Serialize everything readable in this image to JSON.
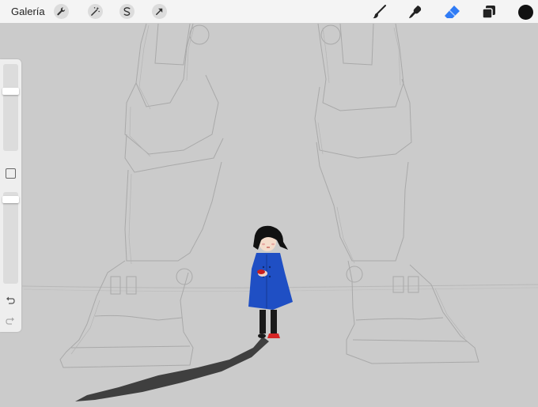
{
  "toolbar": {
    "gallery_label": "Galería",
    "left_tools": [
      "wrench-icon",
      "magic-wand-icon",
      "selection-icon",
      "transform-arrow-icon"
    ],
    "right_tools": [
      "brush-icon",
      "smudge-icon",
      "eraser-icon",
      "layers-icon",
      "color-swatch"
    ],
    "active_tool": "eraser",
    "accent_color": "#2f7bf5",
    "current_color": "#111111"
  },
  "sidebar": {
    "brush_size_level": 0.3,
    "opacity_level": 0.05,
    "buttons": [
      "modifier-button",
      "undo-icon",
      "redo-icon"
    ]
  },
  "canvas": {
    "background_color": "#cbcbcb",
    "coat_color": "#1f4fc4",
    "shoe_color": "#d62626"
  }
}
